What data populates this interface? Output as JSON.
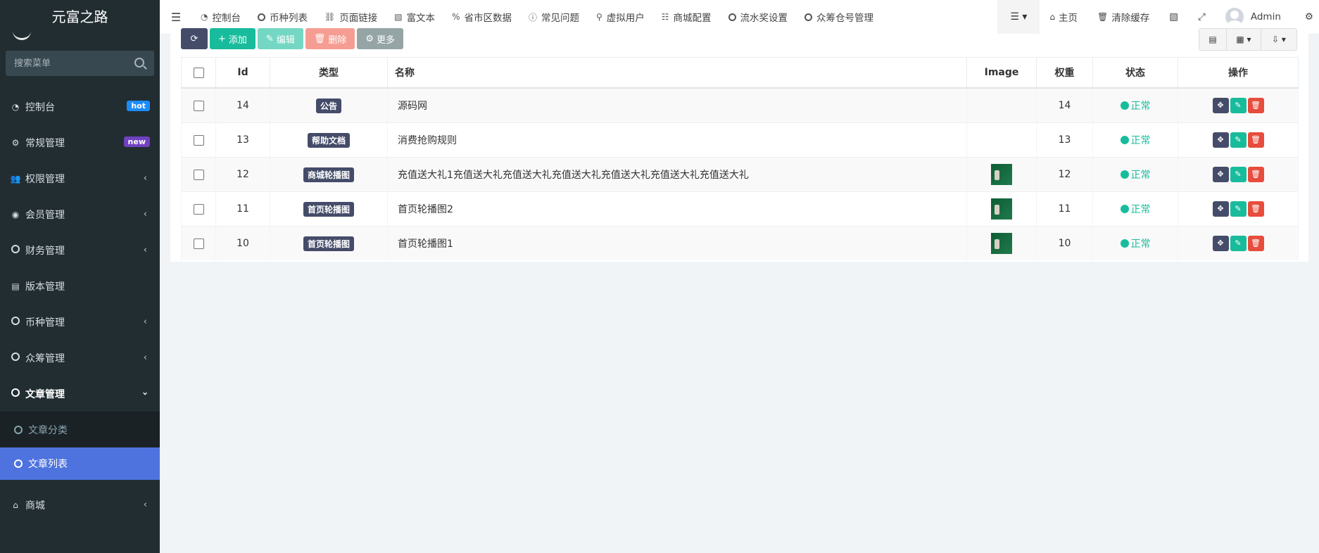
{
  "brand": "元富之路",
  "search": {
    "placeholder": "搜索菜单"
  },
  "sidebar": {
    "items": [
      {
        "label": "控制台",
        "badge": "hot"
      },
      {
        "label": "常规管理",
        "badge": "new"
      },
      {
        "label": "权限管理"
      },
      {
        "label": "会员管理"
      },
      {
        "label": "财务管理"
      },
      {
        "label": "版本管理"
      },
      {
        "label": "币种管理"
      },
      {
        "label": "众筹管理"
      },
      {
        "label": "文章管理"
      },
      {
        "label": "商城"
      }
    ],
    "submenu": [
      {
        "label": "文章分类"
      },
      {
        "label": "文章列表"
      }
    ]
  },
  "navbar": {
    "tabs": [
      {
        "label": "控制台"
      },
      {
        "label": "币种列表"
      },
      {
        "label": "页面链接"
      },
      {
        "label": "富文本"
      },
      {
        "label": "省市区数据"
      },
      {
        "label": "常见问题"
      },
      {
        "label": "虚拟用户"
      },
      {
        "label": "商城配置"
      },
      {
        "label": "流水奖设置"
      },
      {
        "label": "众筹仓号管理"
      }
    ],
    "home": "主页",
    "clear_cache": "清除缓存",
    "user": "Admin"
  },
  "toolbar": {
    "add": "添加",
    "edit": "编辑",
    "delete": "删除",
    "more": "更多"
  },
  "table": {
    "headers": {
      "id": "Id",
      "type": "类型",
      "name": "名称",
      "image": "Image",
      "weight": "权重",
      "status": "状态",
      "ops": "操作"
    },
    "rows": [
      {
        "id": "14",
        "type": "公告",
        "name": "源码网",
        "has_image": false,
        "weight": "14",
        "status": "正常"
      },
      {
        "id": "13",
        "type": "帮助文档",
        "name": "消费抢购规则",
        "has_image": false,
        "weight": "13",
        "status": "正常"
      },
      {
        "id": "12",
        "type": "商城轮播图",
        "name": "充值送大礼1充值送大礼充值送大礼充值送大礼充值送大礼充值送大礼充值送大礼",
        "has_image": true,
        "weight": "12",
        "status": "正常"
      },
      {
        "id": "11",
        "type": "首页轮播图",
        "name": "首页轮播图2",
        "has_image": true,
        "weight": "11",
        "status": "正常"
      },
      {
        "id": "10",
        "type": "首页轮播图",
        "name": "首页轮播图1",
        "has_image": true,
        "weight": "10",
        "status": "正常"
      }
    ]
  },
  "colors": {
    "accent": "#18bc9c",
    "danger": "#e74c3c",
    "dark": "#444c69",
    "sidebar": "#222d32",
    "active": "#4e73df"
  }
}
